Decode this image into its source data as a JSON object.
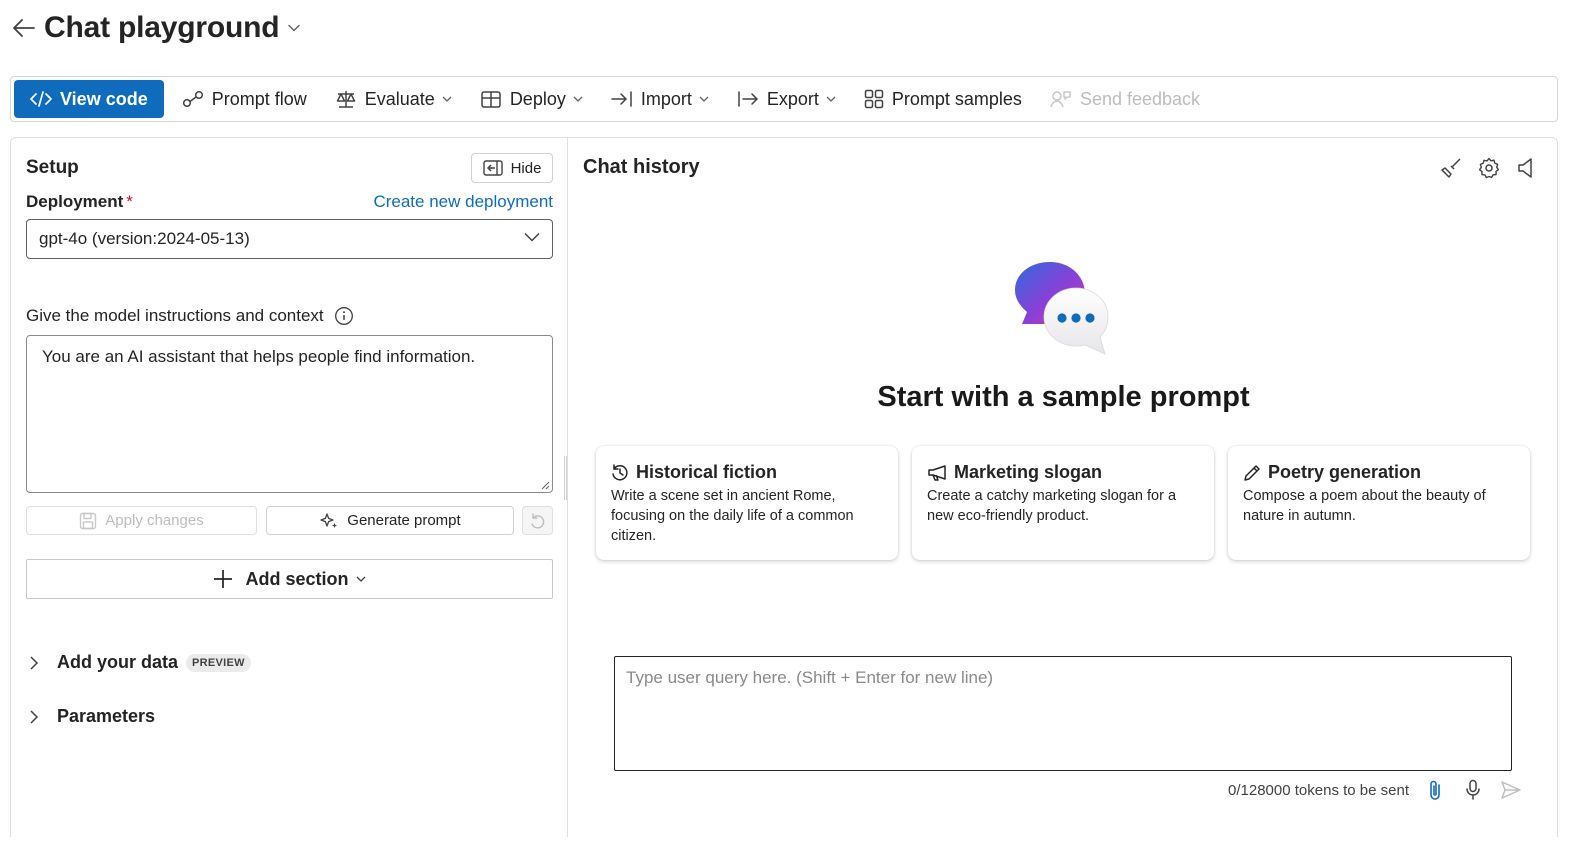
{
  "header": {
    "title": "Chat playground"
  },
  "toolbar": {
    "view_code": "View code",
    "prompt_flow": "Prompt flow",
    "evaluate": "Evaluate",
    "deploy": "Deploy",
    "import": "Import",
    "export": "Export",
    "prompt_samples": "Prompt samples",
    "send_feedback": "Send feedback"
  },
  "setup": {
    "title": "Setup",
    "hide_label": "Hide",
    "deployment_label": "Deployment",
    "required_mark": "*",
    "create_deployment_link": "Create new deployment",
    "deployment_value": "gpt-4o (version:2024-05-13)",
    "instructions_label": "Give the model instructions and context",
    "instructions_value": "You are an AI assistant that helps people find information.",
    "apply_changes": "Apply changes",
    "generate_prompt": "Generate prompt",
    "add_section": "Add section",
    "add_your_data": "Add your data",
    "preview_badge": "PREVIEW",
    "parameters": "Parameters"
  },
  "chat": {
    "title": "Chat history",
    "hero_title": "Start with a sample prompt",
    "samples": [
      {
        "icon": "history-icon",
        "title": "Historical fiction",
        "description": "Write a scene set in ancient Rome, focusing on the daily life of a common citizen."
      },
      {
        "icon": "megaphone-icon",
        "title": "Marketing slogan",
        "description": "Create a catchy marketing slogan for a new eco-friendly product."
      },
      {
        "icon": "pen-icon",
        "title": "Poetry generation",
        "description": "Compose a poem about the beauty of nature in autumn."
      }
    ],
    "query_placeholder": "Type user query here. (Shift + Enter for new line)",
    "token_count": "0/128000 tokens to be sent"
  },
  "colors": {
    "accent": "#0f6cbd",
    "required": "#c50f1f",
    "disabled_text": "#bdbdbd"
  }
}
